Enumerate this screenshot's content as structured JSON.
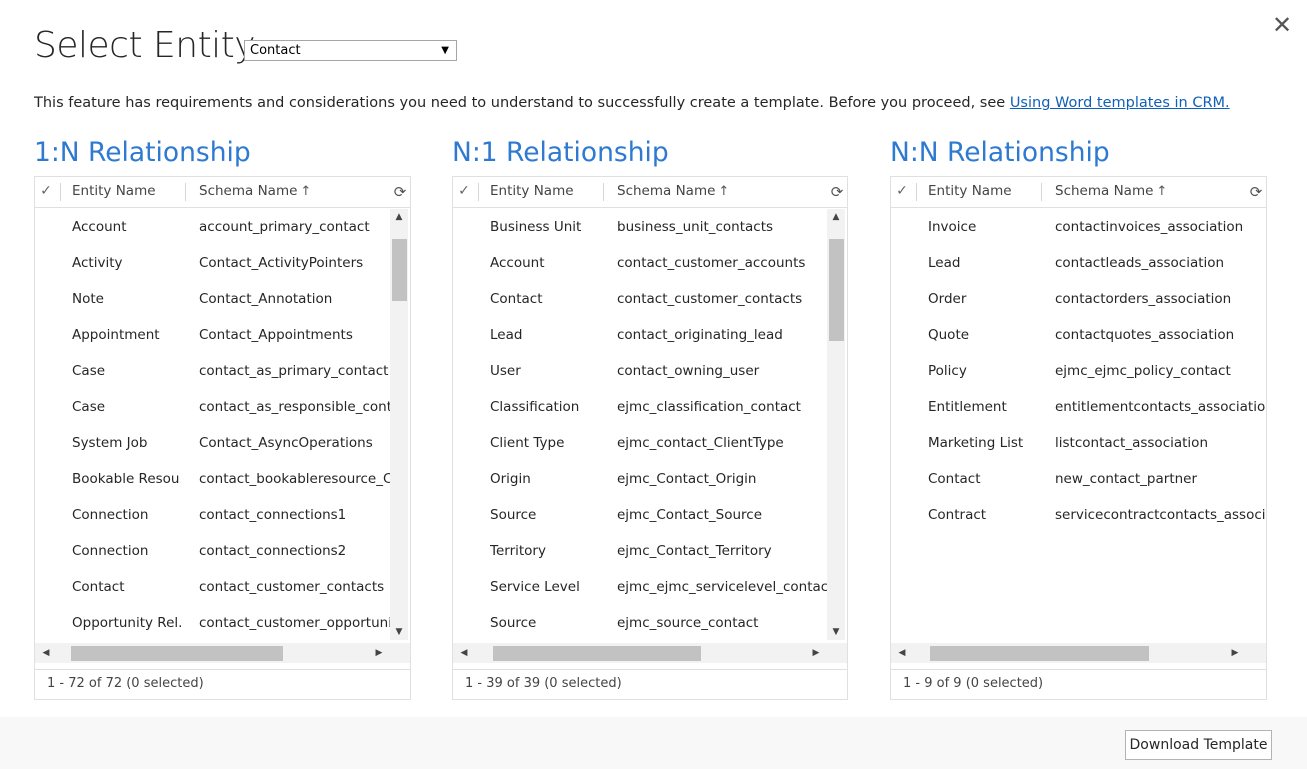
{
  "dialog": {
    "title": "Select Entity",
    "close_glyph": "✕",
    "entity_select": {
      "value": "Contact",
      "arrow": "▼"
    },
    "notice_text": "This feature has requirements and considerations you need to understand to successfully create a template. Before you proceed, see ",
    "notice_link": "Using Word templates in CRM.",
    "download_label": "Download Template"
  },
  "icons": {
    "check": "✓",
    "refresh": "⟳",
    "sort_up": "↑",
    "scroll_up": "▲",
    "scroll_down": "▼",
    "scroll_left": "◀",
    "scroll_right": "▶"
  },
  "panels": [
    {
      "title": "1:N Relationship",
      "col_entity": "Entity Name",
      "col_schema": "Schema Name",
      "footer": "1 - 72 of 72 (0 selected)",
      "vscroll_thumb": [
        0.035,
        0.19
      ],
      "hscroll_thumb": [
        0.05,
        0.72
      ],
      "rows": [
        {
          "entity": "Account",
          "schema": "account_primary_contact"
        },
        {
          "entity": "Activity",
          "schema": "Contact_ActivityPointers"
        },
        {
          "entity": "Note",
          "schema": "Contact_Annotation"
        },
        {
          "entity": "Appointment",
          "schema": "Contact_Appointments"
        },
        {
          "entity": "Case",
          "schema": "contact_as_primary_contact"
        },
        {
          "entity": "Case",
          "schema": "contact_as_responsible_contact"
        },
        {
          "entity": "System Job",
          "schema": "Contact_AsyncOperations"
        },
        {
          "entity": "Bookable Resou...",
          "schema": "contact_bookableresource_Contact"
        },
        {
          "entity": "Connection",
          "schema": "contact_connections1"
        },
        {
          "entity": "Connection",
          "schema": "contact_connections2"
        },
        {
          "entity": "Contact",
          "schema": "contact_customer_contacts"
        },
        {
          "entity": "Opportunity Rel...",
          "schema": "contact_customer_opportunity_roles"
        }
      ]
    },
    {
      "title": "N:1 Relationship",
      "col_entity": "Entity Name",
      "col_schema": "Schema Name",
      "footer": "1 - 39 of 39 (0 selected)",
      "vscroll_thumb": [
        0.035,
        0.29
      ],
      "hscroll_thumb": [
        0.06,
        0.68
      ],
      "rows": [
        {
          "entity": "Business Unit",
          "schema": "business_unit_contacts"
        },
        {
          "entity": "Account",
          "schema": "contact_customer_accounts"
        },
        {
          "entity": "Contact",
          "schema": "contact_customer_contacts"
        },
        {
          "entity": "Lead",
          "schema": "contact_originating_lead"
        },
        {
          "entity": "User",
          "schema": "contact_owning_user"
        },
        {
          "entity": "Classification",
          "schema": "ejmc_classification_contact"
        },
        {
          "entity": "Client Type",
          "schema": "ejmc_contact_ClientType"
        },
        {
          "entity": "Origin",
          "schema": "ejmc_Contact_Origin"
        },
        {
          "entity": "Source",
          "schema": "ejmc_Contact_Source"
        },
        {
          "entity": "Territory",
          "schema": "ejmc_Contact_Territory"
        },
        {
          "entity": "Service Level",
          "schema": "ejmc_ejmc_servicelevel_contact_ServiceLevel"
        },
        {
          "entity": "Source",
          "schema": "ejmc_source_contact"
        }
      ]
    },
    {
      "title": "N:N Relationship",
      "col_entity": "Entity Name",
      "col_schema": "Schema Name",
      "footer": "1 - 9 of 9 (0 selected)",
      "vscroll_thumb": null,
      "hscroll_thumb": [
        0.06,
        0.75
      ],
      "rows": [
        {
          "entity": "Invoice",
          "schema": "contactinvoices_association"
        },
        {
          "entity": "Lead",
          "schema": "contactleads_association"
        },
        {
          "entity": "Order",
          "schema": "contactorders_association"
        },
        {
          "entity": "Quote",
          "schema": "contactquotes_association"
        },
        {
          "entity": "Policy",
          "schema": "ejmc_ejmc_policy_contact"
        },
        {
          "entity": "Entitlement",
          "schema": "entitlementcontacts_association"
        },
        {
          "entity": "Marketing List",
          "schema": "listcontact_association"
        },
        {
          "entity": "Contact",
          "schema": "new_contact_partner"
        },
        {
          "entity": "Contract",
          "schema": "servicecontractcontacts_association"
        }
      ]
    }
  ]
}
